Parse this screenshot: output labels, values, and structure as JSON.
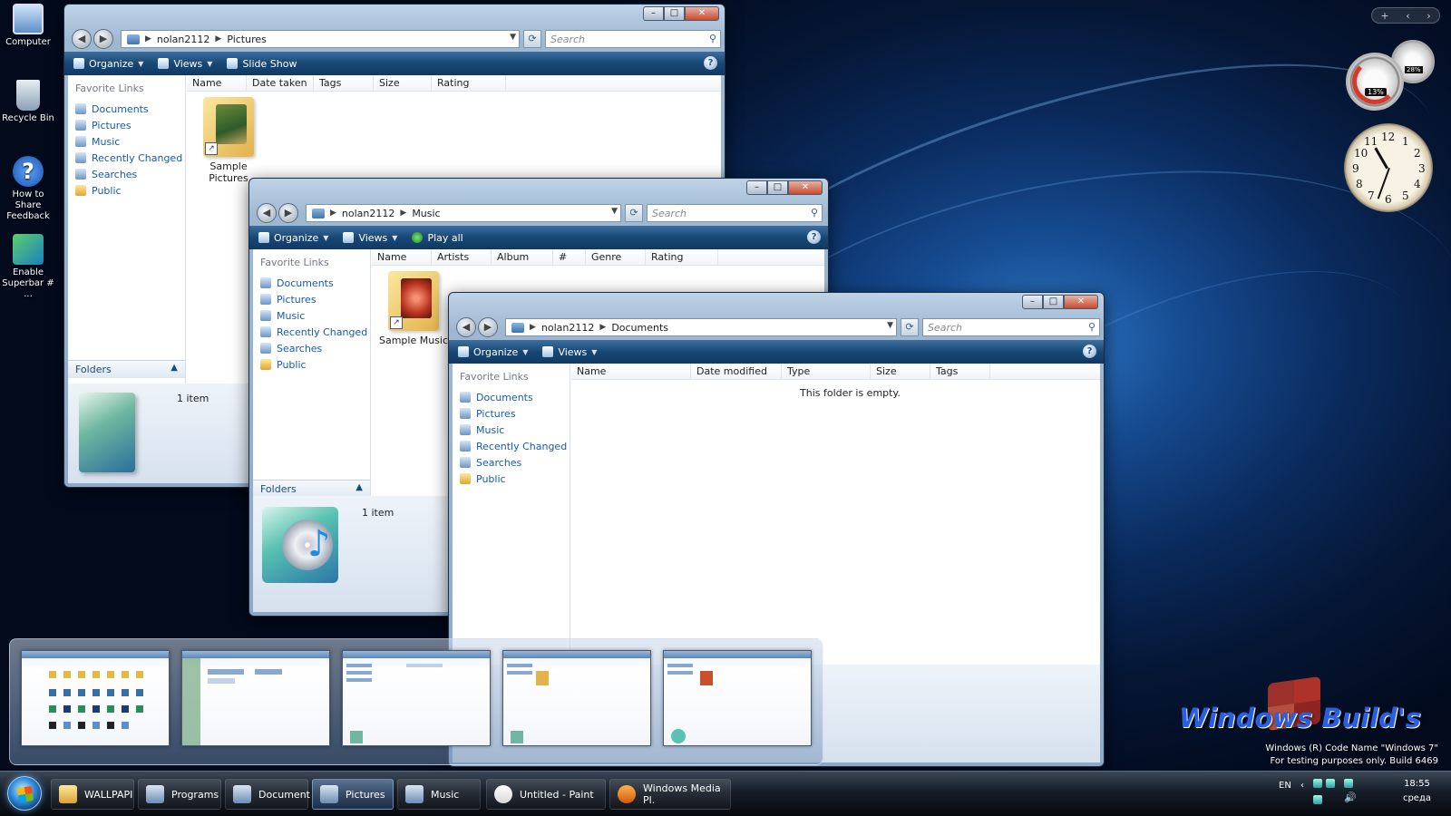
{
  "desktop": {
    "icons": [
      {
        "label": "Computer"
      },
      {
        "label": "Recycle Bin"
      },
      {
        "label": "How to Share Feedback"
      },
      {
        "label": "Enable Superbar # ..."
      }
    ]
  },
  "nav_links": [
    "Documents",
    "Pictures",
    "Music",
    "Recently Changed",
    "Searches",
    "Public"
  ],
  "favorite_links_label": "Favorite Links",
  "folders_label": "Folders",
  "search_placeholder": "Search",
  "windows": {
    "pictures": {
      "breadcrumb": [
        "nolan2112",
        "Pictures"
      ],
      "commands": {
        "organize": "Organize",
        "views": "Views",
        "slideshow": "Slide Show"
      },
      "columns": [
        "Name",
        "Date taken",
        "Tags",
        "Size",
        "Rating"
      ],
      "item": "Sample Pictures",
      "count": "1 item"
    },
    "music": {
      "breadcrumb": [
        "nolan2112",
        "Music"
      ],
      "commands": {
        "organize": "Organize",
        "views": "Views",
        "playall": "Play all"
      },
      "columns": [
        "Name",
        "Artists",
        "Album",
        "#",
        "Genre",
        "Rating"
      ],
      "item": "Sample Music",
      "count": "1 item"
    },
    "documents": {
      "breadcrumb": [
        "nolan2112",
        "Documents"
      ],
      "commands": {
        "organize": "Organize",
        "views": "Views"
      },
      "columns": [
        "Name",
        "Date modified",
        "Type",
        "Size",
        "Tags"
      ],
      "empty_text": "This folder is empty."
    }
  },
  "taskbar": {
    "buttons": [
      {
        "label": "WALLPAPI",
        "icon": "folder-icon"
      },
      {
        "label": "Programs",
        "icon": "explorer-icon"
      },
      {
        "label": "Document",
        "icon": "explorer-icon"
      },
      {
        "label": "Pictures",
        "icon": "explorer-icon",
        "active": true
      },
      {
        "label": "Music",
        "icon": "explorer-icon"
      },
      {
        "label": "Untitled - Paint",
        "icon": "paint-icon"
      },
      {
        "label": "Windows Media Pl.",
        "icon": "media-player-icon"
      }
    ],
    "tray": {
      "language": "EN",
      "time": "18:55",
      "day": "среда"
    }
  },
  "gadgets": {
    "cpu": "13%",
    "mem": "28%"
  },
  "watermark": {
    "logo_text": "Windows Build's",
    "build_line1": "Windows (R) Code Name \"Windows 7\"",
    "build_line2": "For testing purposes only. Build 6469"
  }
}
